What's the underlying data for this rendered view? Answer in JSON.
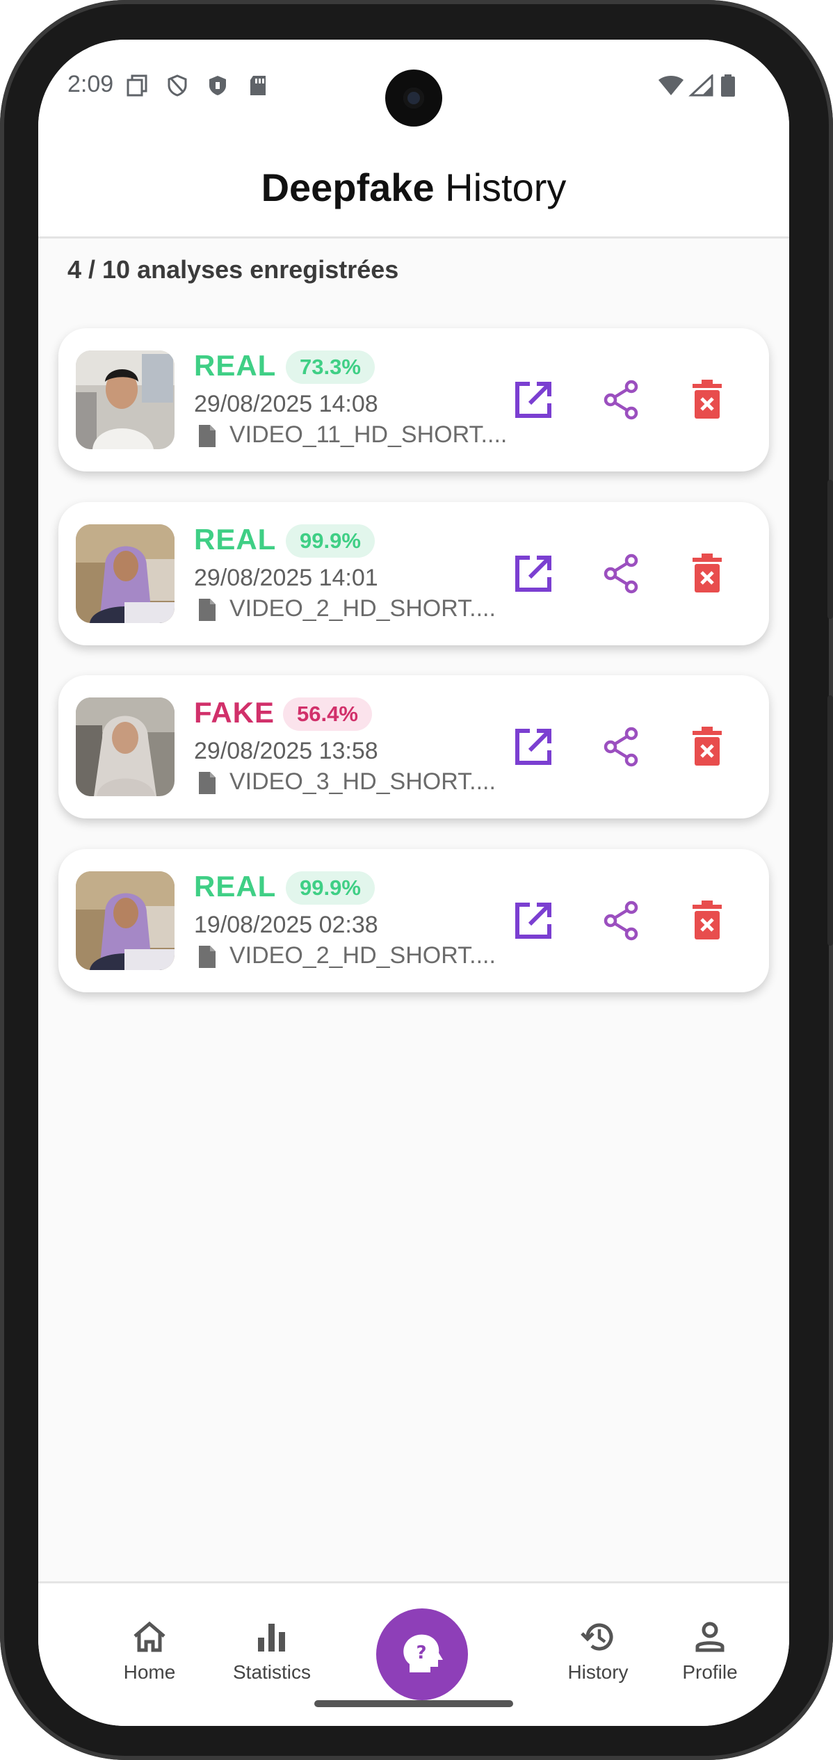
{
  "status_bar": {
    "time": "2:09",
    "left_icons": [
      "copy-icon",
      "shield-outline-icon",
      "shield-filled-icon",
      "sd-card-icon"
    ],
    "right_icons": [
      "wifi-icon",
      "signal-icon",
      "battery-icon"
    ]
  },
  "app_bar": {
    "title_bold": "Deepfake",
    "title_light": "History"
  },
  "summary": {
    "count_text": "4 / 10 analyses enregistrées"
  },
  "colors": {
    "real": "#3fcf85",
    "real_badge_bg": "#e2f6ec",
    "fake": "#d1306a",
    "fake_badge_bg": "#fbe3ec",
    "accent_purple": "#7b3fd1",
    "share_purple": "#9b4fbf",
    "delete_red": "#e84d4d",
    "fab": "#8e3fb8"
  },
  "history": [
    {
      "label": "REAL",
      "confidence": "73.3%",
      "date": "29/08/2025 14:08",
      "file": "VIDEO_11_HD_SHORT...."
    },
    {
      "label": "REAL",
      "confidence": "99.9%",
      "date": "29/08/2025 14:01",
      "file": "VIDEO_2_HD_SHORT...."
    },
    {
      "label": "FAKE",
      "confidence": "56.4%",
      "date": "29/08/2025 13:58",
      "file": "VIDEO_3_HD_SHORT...."
    },
    {
      "label": "REAL",
      "confidence": "99.9%",
      "date": "19/08/2025 02:38",
      "file": "VIDEO_2_HD_SHORT...."
    }
  ],
  "card_actions": [
    "open-external-icon",
    "share-icon",
    "delete-icon"
  ],
  "bottom_nav": {
    "items": [
      {
        "label": "Home",
        "icon": "home-icon"
      },
      {
        "label": "Statistics",
        "icon": "bar-chart-icon"
      },
      {
        "label": "History",
        "icon": "history-icon"
      },
      {
        "label": "Profile",
        "icon": "person-icon"
      }
    ],
    "fab_icon": "head-question-icon"
  }
}
